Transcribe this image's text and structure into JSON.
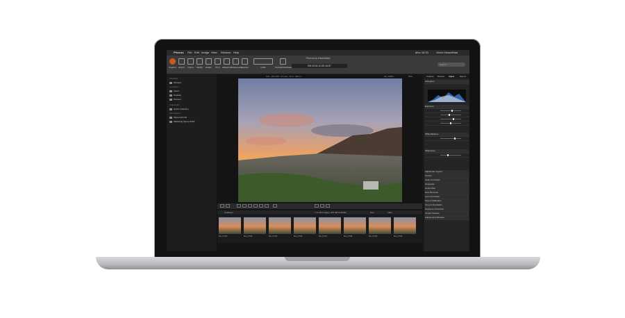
{
  "menubar": {
    "apple": "",
    "items": [
      "Phocus",
      "File",
      "Edit",
      "Image",
      "View",
      "Window",
      "Help"
    ],
    "status": "Mon 18:20",
    "user": "Victor Hasselblad"
  },
  "window_title": "Phocus by Hasselblad",
  "toolbar": {
    "buttons": [
      "Capture",
      "Export",
      "Import",
      "Modify",
      "Delete",
      "Print",
      "Slideshow",
      "Preferences",
      "Layouts"
    ],
    "image_field": "EM 2016-11-05 16:57",
    "group_labels": [
      "Grids",
      "PortraitLandscape",
      "Adjustments"
    ],
    "search_placeholder": "Search"
  },
  "left_panel": {
    "section_header": "Favorites",
    "items": [
      "Pictures",
      "Locations",
      "Users",
      "Desktop",
      "Pictures"
    ],
    "collections_header": "Collections",
    "collection_item": "Quick Collection",
    "network_header": "File System",
    "network_items": [
      "Macintosh HD",
      "Marketing Spring 2018"
    ]
  },
  "viewer": {
    "info": "100 - ISO 100 - 5.6 sec - f/4.0 - 50mm",
    "filename": "EA_09991",
    "zoom": "50%"
  },
  "browser": {
    "tab_label": "Cataloger",
    "count_text": "7 of 194 images, 303 GB available",
    "sort_label": "Sort",
    "filter_label": "Filter"
  },
  "thumbnails": [
    "EA_0723",
    "EA_0724",
    "EA_0725",
    "EA_0726",
    "EA_0727",
    "EA_0728",
    "EA_0729",
    "EA_0730"
  ],
  "right_panel": {
    "tabs": [
      "Capture",
      "Browse",
      "Adjust",
      "Export"
    ],
    "tools": [
      "Histogram",
      "Exposure",
      "White Balance",
      "Sharpness",
      "Adjustment Layers",
      "Curves",
      "Color Correction",
      "Grayscale",
      "Noise Filter",
      "Dust Removal",
      "Lens Correction",
      "Scene Calibration",
      "Crop & Orientation",
      "Keystone Correction",
      "Output Preview",
      "Adjustments Browser"
    ]
  },
  "colors": {
    "screen_bg": "#1c1c1e",
    "accent": "#c75a1e",
    "panel_bg": "#242426"
  }
}
